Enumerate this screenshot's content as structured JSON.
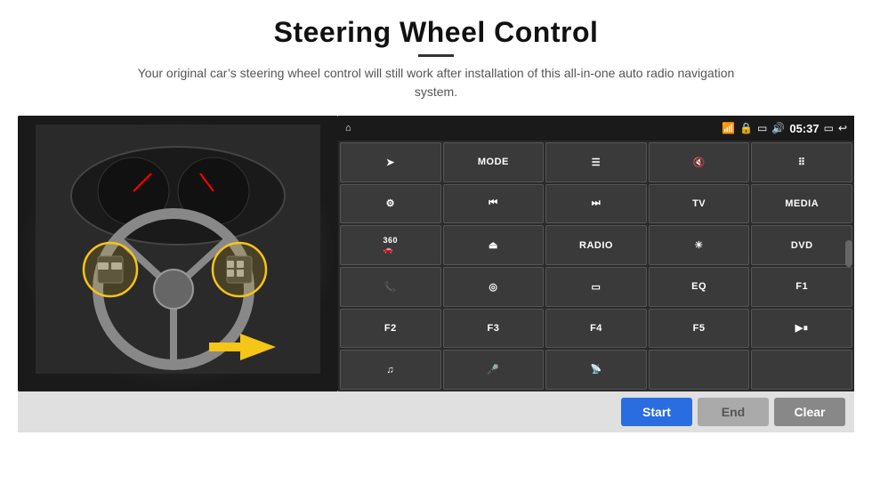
{
  "header": {
    "title": "Steering Wheel Control",
    "subtitle": "Your original car’s steering wheel control will still work after installation of this all-in-one auto radio navigation system."
  },
  "status_bar": {
    "home_icon": "⌂",
    "wifi_icon": "□",
    "bluetooth_icon": "□",
    "lock_icon": "□",
    "sound_icon": "□",
    "time": "05:37",
    "back_icon": "↺"
  },
  "grid_buttons": [
    {
      "id": "btn-send",
      "label": "➤",
      "type": "icon"
    },
    {
      "id": "btn-mode",
      "label": "MODE",
      "type": "text"
    },
    {
      "id": "btn-list",
      "label": "☰",
      "type": "icon"
    },
    {
      "id": "btn-mute",
      "label": "🔇",
      "type": "icon"
    },
    {
      "id": "btn-dots",
      "label": "⠇",
      "type": "icon"
    },
    {
      "id": "btn-settings",
      "label": "⚙",
      "type": "icon"
    },
    {
      "id": "btn-prev",
      "label": "⏪",
      "type": "icon"
    },
    {
      "id": "btn-next",
      "label": "⏩",
      "type": "icon"
    },
    {
      "id": "btn-tv",
      "label": "TV",
      "type": "text"
    },
    {
      "id": "btn-media",
      "label": "MEDIA",
      "type": "text"
    },
    {
      "id": "btn-360",
      "label": "360□",
      "type": "icon"
    },
    {
      "id": "btn-eject",
      "label": "⏏",
      "type": "icon"
    },
    {
      "id": "btn-radio",
      "label": "RADIO",
      "type": "text"
    },
    {
      "id": "btn-bright",
      "label": "☀",
      "type": "icon"
    },
    {
      "id": "btn-dvd",
      "label": "DVD",
      "type": "text"
    },
    {
      "id": "btn-phone",
      "label": "✆",
      "type": "icon"
    },
    {
      "id": "btn-nav",
      "label": "◎",
      "type": "icon"
    },
    {
      "id": "btn-dash",
      "label": "━",
      "type": "icon"
    },
    {
      "id": "btn-eq",
      "label": "EQ",
      "type": "text"
    },
    {
      "id": "btn-f1",
      "label": "F1",
      "type": "text"
    },
    {
      "id": "btn-f2",
      "label": "F2",
      "type": "text"
    },
    {
      "id": "btn-f3",
      "label": "F3",
      "type": "text"
    },
    {
      "id": "btn-f4",
      "label": "F4",
      "type": "text"
    },
    {
      "id": "btn-f5",
      "label": "F5",
      "type": "text"
    },
    {
      "id": "btn-playpause",
      "label": "▶⏸",
      "type": "icon"
    },
    {
      "id": "btn-music",
      "label": "♫",
      "type": "icon"
    },
    {
      "id": "btn-mic",
      "label": "🎤",
      "type": "icon"
    },
    {
      "id": "btn-call",
      "label": "📡",
      "type": "icon"
    },
    {
      "id": "btn-empty1",
      "label": "",
      "type": "empty"
    },
    {
      "id": "btn-empty2",
      "label": "",
      "type": "empty"
    }
  ],
  "bottom_bar": {
    "start_label": "Start",
    "end_label": "End",
    "clear_label": "Clear"
  }
}
